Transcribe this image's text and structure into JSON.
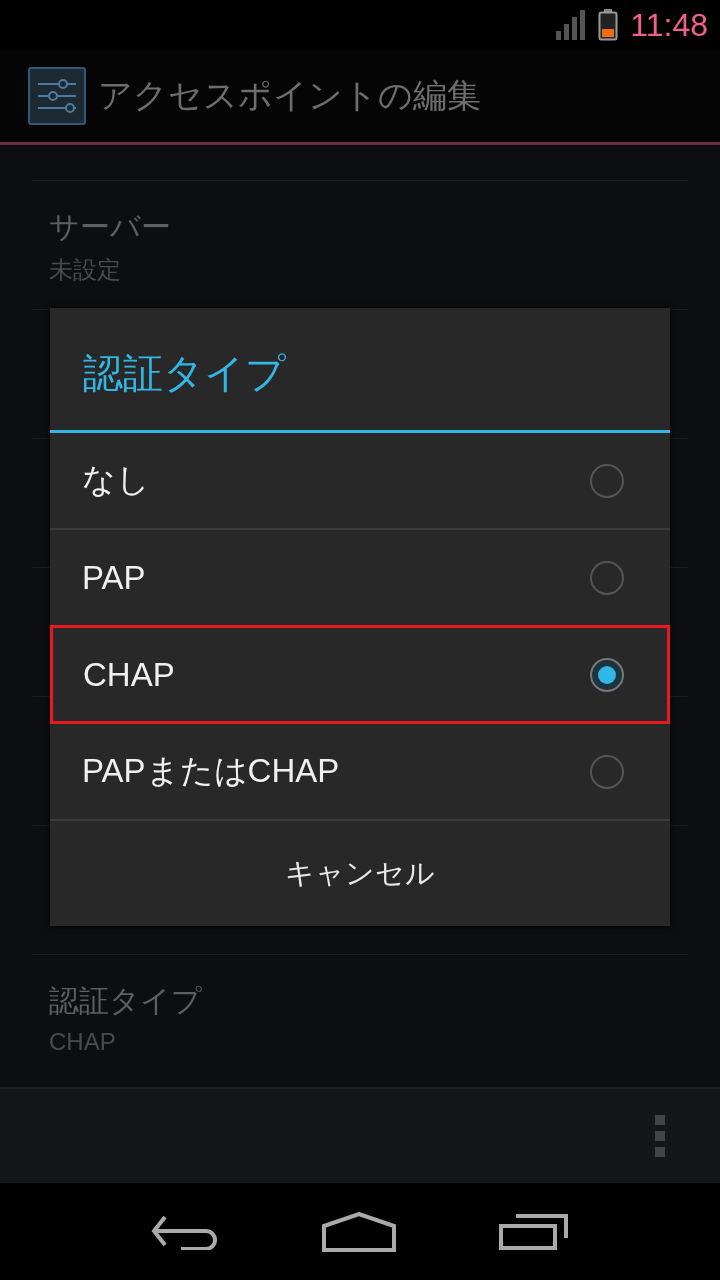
{
  "status_bar": {
    "time": "11:48"
  },
  "action_bar": {
    "title": "アクセスポイントの編集"
  },
  "settings": [
    {
      "title": "サーバー",
      "summary": "未設定"
    },
    {
      "title": "認証タイプ",
      "summary": "CHAP"
    }
  ],
  "dialog": {
    "title": "認証タイプ",
    "options": [
      {
        "label": "なし",
        "selected": false,
        "highlighted": false
      },
      {
        "label": "PAP",
        "selected": false,
        "highlighted": false
      },
      {
        "label": "CHAP",
        "selected": true,
        "highlighted": true
      },
      {
        "label": "PAPまたはCHAP",
        "selected": false,
        "highlighted": false
      }
    ],
    "cancel": "キャンセル"
  }
}
